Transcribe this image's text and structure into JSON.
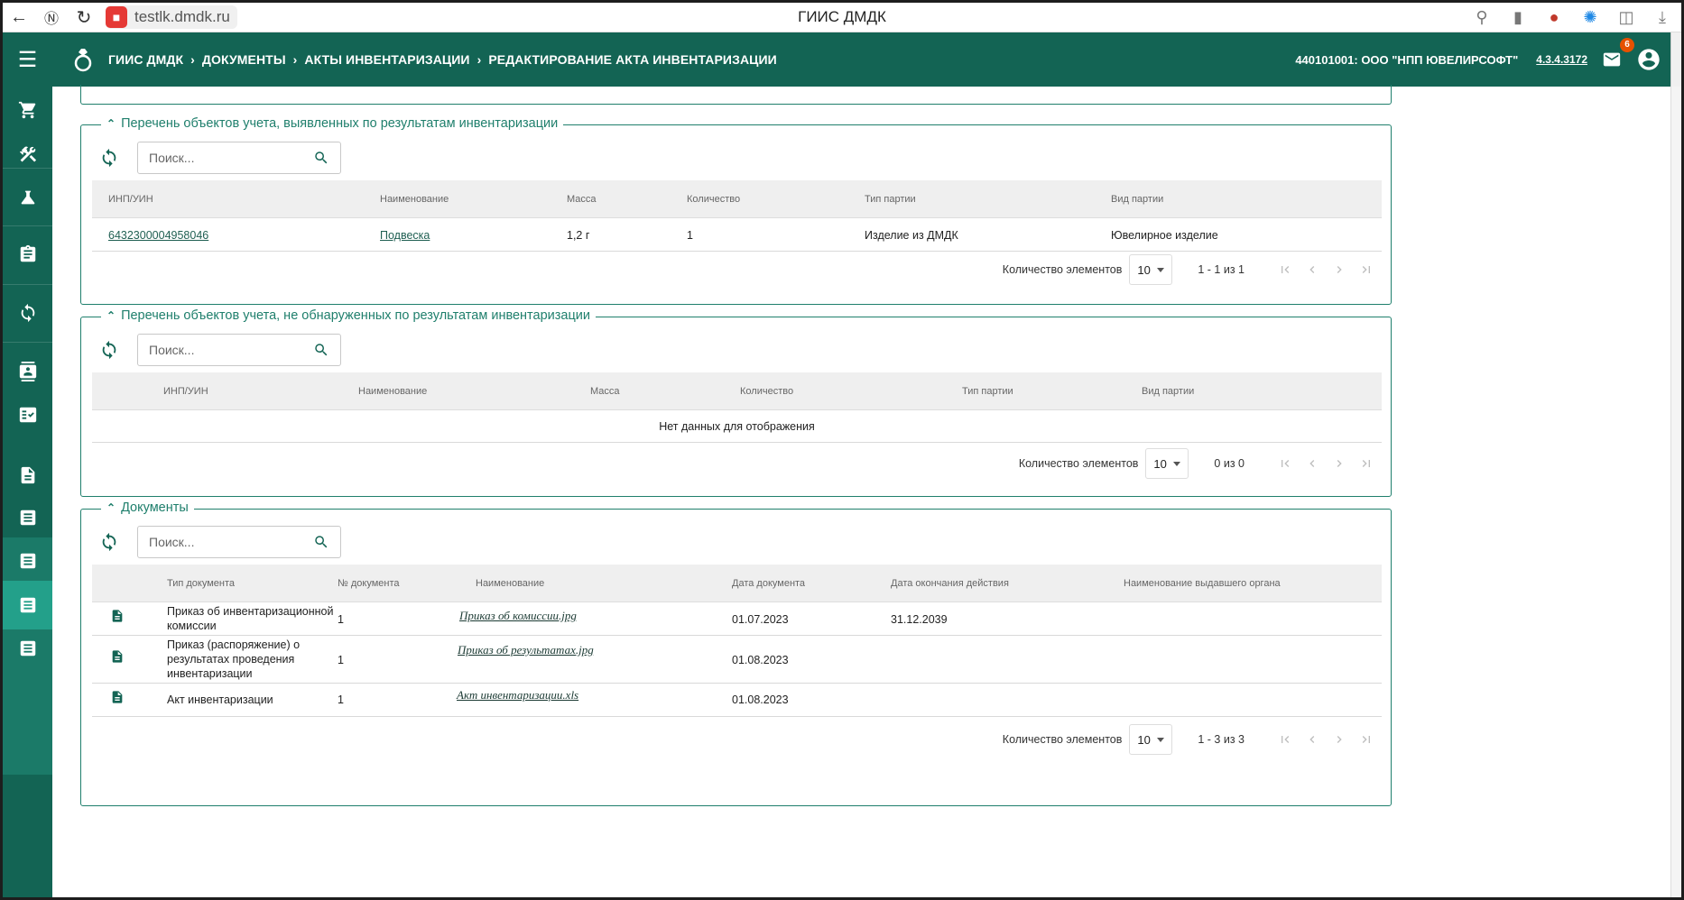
{
  "browser": {
    "url": "testlk.dmdk.ru",
    "title": "ГИИС ДМДК"
  },
  "header": {
    "breadcrumbs": [
      "ГИИС ДМДК",
      "ДОКУМЕНТЫ",
      "АКТЫ ИНВЕНТАРИЗАЦИИ",
      "РЕДАКТИРОВАНИЕ АКТА ИНВЕНТАРИЗАЦИИ"
    ],
    "organization": "440101001: ООО \"НПП ЮВЕЛИРСОФТ\"",
    "version": "4.3.4.3172",
    "mail_badge": "6"
  },
  "colors": {
    "brand": "#136454",
    "accent": "#1f7f6c",
    "badge": "#e65100"
  },
  "icons": {
    "sidebar": [
      "cart-icon",
      "tools-icon",
      "flask-icon",
      "clipboard-icon",
      "sync-icon",
      "contact-icon",
      "checklist-icon",
      "document-icon",
      "list-icon",
      "list-icon",
      "list-icon",
      "list-icon"
    ]
  },
  "found": {
    "title": "Перечень объектов учета, выявленных по результатам инвентаризации",
    "search_placeholder": "Поиск...",
    "columns": [
      "ИНП/УИН",
      "Наименование",
      "Масса",
      "Количество",
      "Тип партии",
      "Вид партии"
    ],
    "rows": [
      {
        "uin": "6432300004958046",
        "name": "Подвеска",
        "mass": "1,2 г",
        "qty": "1",
        "batch_type": "Изделие из ДМДК",
        "batch_kind": "Ювелирное изделие"
      }
    ],
    "pager": {
      "label": "Количество элементов",
      "size": "10",
      "range": "1 - 1 из 1"
    }
  },
  "notfound": {
    "title": "Перечень объектов учета, не обнаруженных по результатам инвентаризации",
    "search_placeholder": "Поиск...",
    "columns": [
      "ИНП/УИН",
      "Наименование",
      "Масса",
      "Количество",
      "Тип партии",
      "Вид партии"
    ],
    "empty": "Нет данных для отображения",
    "pager": {
      "label": "Количество элементов",
      "size": "10",
      "range": "0 из 0"
    }
  },
  "docs": {
    "title": "Документы",
    "search_placeholder": "Поиск...",
    "columns": [
      "Тип документа",
      "№ документа",
      "Наименование",
      "Дата документа",
      "Дата окончания действия",
      "Наименование выдавшего органа"
    ],
    "rows": [
      {
        "type_l1": "Приказ об инвентаризационной",
        "type_l2": "комиссии",
        "type_l3": "",
        "num": "1",
        "file": "Приказ об комиссии.jpg",
        "date": "01.07.2023",
        "end": "31.12.2039",
        "issuer": ""
      },
      {
        "type_l1": "Приказ (распоряжение) о",
        "type_l2": "результатах проведения",
        "type_l3": "инвентаризации",
        "num": "1",
        "file": "Приказ об результатах.jpg",
        "date": "01.08.2023",
        "end": "",
        "issuer": ""
      },
      {
        "type_l1": "Акт инвентаризации",
        "type_l2": "",
        "type_l3": "",
        "num": "1",
        "file": "Акт инвентаризации.xls",
        "date": "01.08.2023",
        "end": "",
        "issuer": ""
      }
    ],
    "pager": {
      "label": "Количество элементов",
      "size": "10",
      "range": "1 - 3 из 3"
    }
  }
}
